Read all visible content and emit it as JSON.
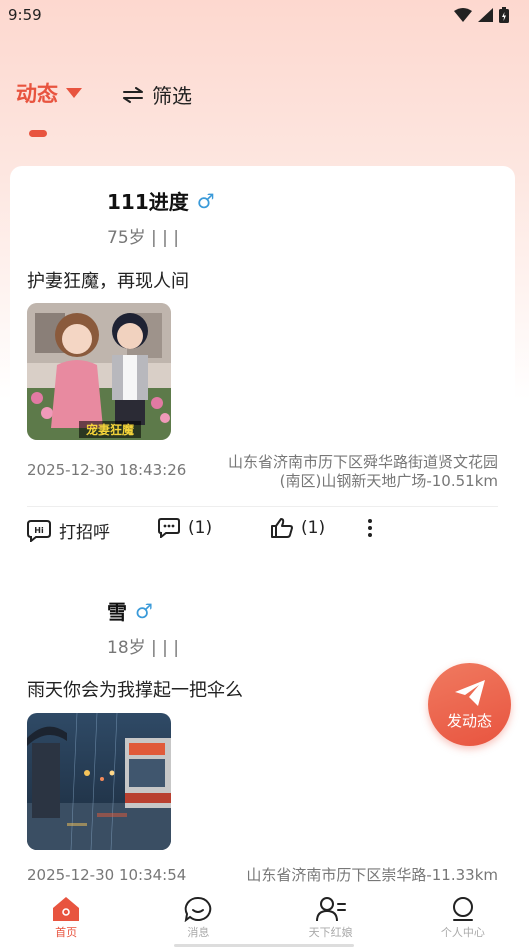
{
  "status": {
    "time": "9:59"
  },
  "header": {
    "active_tab": "动态",
    "filter_label": "筛选"
  },
  "posts": [
    {
      "name": "111进度",
      "gender": "♂",
      "age_line": "75岁 | | |",
      "content": "护妻狂魔，再现人间",
      "image_caption": "宠妻狂魔",
      "time": "2025-12-30 18:43:26",
      "location": "山东省济南市历下区舜华路街道贤文花园(南区)山钢新天地广场-10.51km",
      "greet_label": "打招呼",
      "comment_count": "(1)",
      "like_count": "(1)"
    },
    {
      "name": "雪",
      "gender": "♂",
      "age_line": "18岁 | | |",
      "content": "雨天你会为我撑起一把伞么",
      "time": "2025-12-30 10:34:54",
      "location": "山东省济南市历下区崇华路-11.33km"
    }
  ],
  "fab": {
    "label": "发动态"
  },
  "nav": [
    {
      "label": "首页",
      "icon": "home-icon"
    },
    {
      "label": "消息",
      "icon": "chat-icon"
    },
    {
      "label": "天下红娘",
      "icon": "matchmaker-icon"
    },
    {
      "label": "个人中心",
      "icon": "profile-icon"
    }
  ],
  "colors": {
    "accent": "#e8543f",
    "gender_male": "#3a9ad9"
  }
}
